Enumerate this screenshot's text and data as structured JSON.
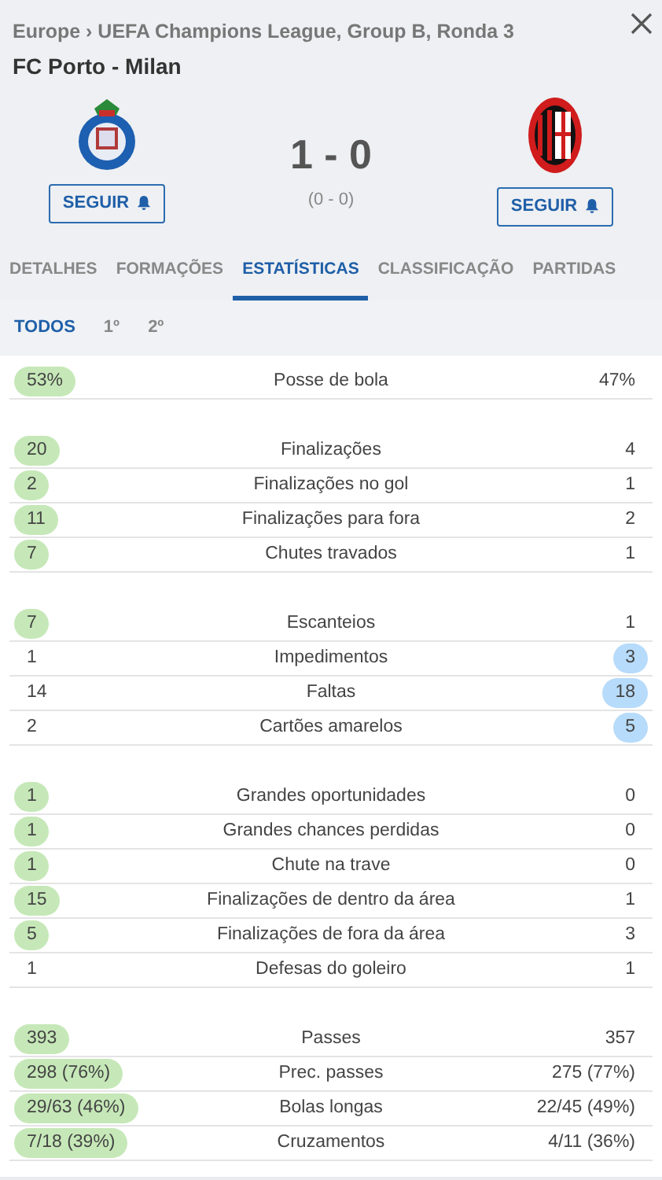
{
  "header": {
    "breadcrumb": [
      "Europe",
      "UEFA Champions League, Group B, Ronda 3"
    ],
    "breadcrumb_separator": "›",
    "title": "FC Porto - Milan"
  },
  "home": {
    "follow_label": "SEGUIR"
  },
  "away": {
    "follow_label": "SEGUIR"
  },
  "score": {
    "full_time": "1 - 0",
    "half_time": "(0 - 0)"
  },
  "tabs": [
    {
      "label": "DETALHES",
      "selected": false
    },
    {
      "label": "FORMAÇÕES",
      "selected": false
    },
    {
      "label": "ESTATÍSTICAS",
      "selected": true
    },
    {
      "label": "CLASSIFICAÇÃO",
      "selected": false
    },
    {
      "label": "PARTIDAS",
      "selected": false
    }
  ],
  "periods": [
    {
      "label": "TODOS",
      "selected": true
    },
    {
      "label": "1º",
      "selected": false
    },
    {
      "label": "2º",
      "selected": false
    }
  ],
  "stat_groups": [
    {
      "rows": [
        {
          "label": "Posse de bola",
          "home": "53%",
          "away": "47%",
          "home_highlighted": true,
          "away_highlighted": false
        }
      ]
    },
    {
      "rows": [
        {
          "label": "Finalizações",
          "home": "20",
          "away": "4",
          "home_highlighted": true,
          "away_highlighted": false
        },
        {
          "label": "Finalizações no gol",
          "home": "2",
          "away": "1",
          "home_highlighted": true,
          "away_highlighted": false
        },
        {
          "label": "Finalizações para fora",
          "home": "11",
          "away": "2",
          "home_highlighted": true,
          "away_highlighted": false
        },
        {
          "label": "Chutes travados",
          "home": "7",
          "away": "1",
          "home_highlighted": true,
          "away_highlighted": false
        }
      ]
    },
    {
      "rows": [
        {
          "label": "Escanteios",
          "home": "7",
          "away": "1",
          "home_highlighted": true,
          "away_highlighted": false
        },
        {
          "label": "Impedimentos",
          "home": "1",
          "away": "3",
          "home_highlighted": false,
          "away_highlighted": true
        },
        {
          "label": "Faltas",
          "home": "14",
          "away": "18",
          "home_highlighted": false,
          "away_highlighted": true
        },
        {
          "label": "Cartões amarelos",
          "home": "2",
          "away": "5",
          "home_highlighted": false,
          "away_highlighted": true
        }
      ]
    },
    {
      "rows": [
        {
          "label": "Grandes oportunidades",
          "home": "1",
          "away": "0",
          "home_highlighted": true,
          "away_highlighted": false
        },
        {
          "label": "Grandes chances perdidas",
          "home": "1",
          "away": "0",
          "home_highlighted": true,
          "away_highlighted": false
        },
        {
          "label": "Chute na trave",
          "home": "1",
          "away": "0",
          "home_highlighted": true,
          "away_highlighted": false
        },
        {
          "label": "Finalizações de dentro da área",
          "home": "15",
          "away": "1",
          "home_highlighted": true,
          "away_highlighted": false
        },
        {
          "label": "Finalizações de fora da área",
          "home": "5",
          "away": "3",
          "home_highlighted": true,
          "away_highlighted": false
        },
        {
          "label": "Defesas do goleiro",
          "home": "1",
          "away": "1",
          "home_highlighted": false,
          "away_highlighted": false
        }
      ]
    },
    {
      "rows": [
        {
          "label": "Passes",
          "home": "393",
          "away": "357",
          "home_highlighted": true,
          "away_highlighted": false
        },
        {
          "label": "Prec. passes",
          "home": "298 (76%)",
          "away": "275 (77%)",
          "home_highlighted": true,
          "away_highlighted": false
        },
        {
          "label": "Bolas longas",
          "home": "29/63 (46%)",
          "away": "22/45 (49%)",
          "home_highlighted": true,
          "away_highlighted": false
        },
        {
          "label": "Cruzamentos",
          "home": "7/18 (39%)",
          "away": "4/11 (36%)",
          "home_highlighted": true,
          "away_highlighted": false
        }
      ]
    }
  ]
}
